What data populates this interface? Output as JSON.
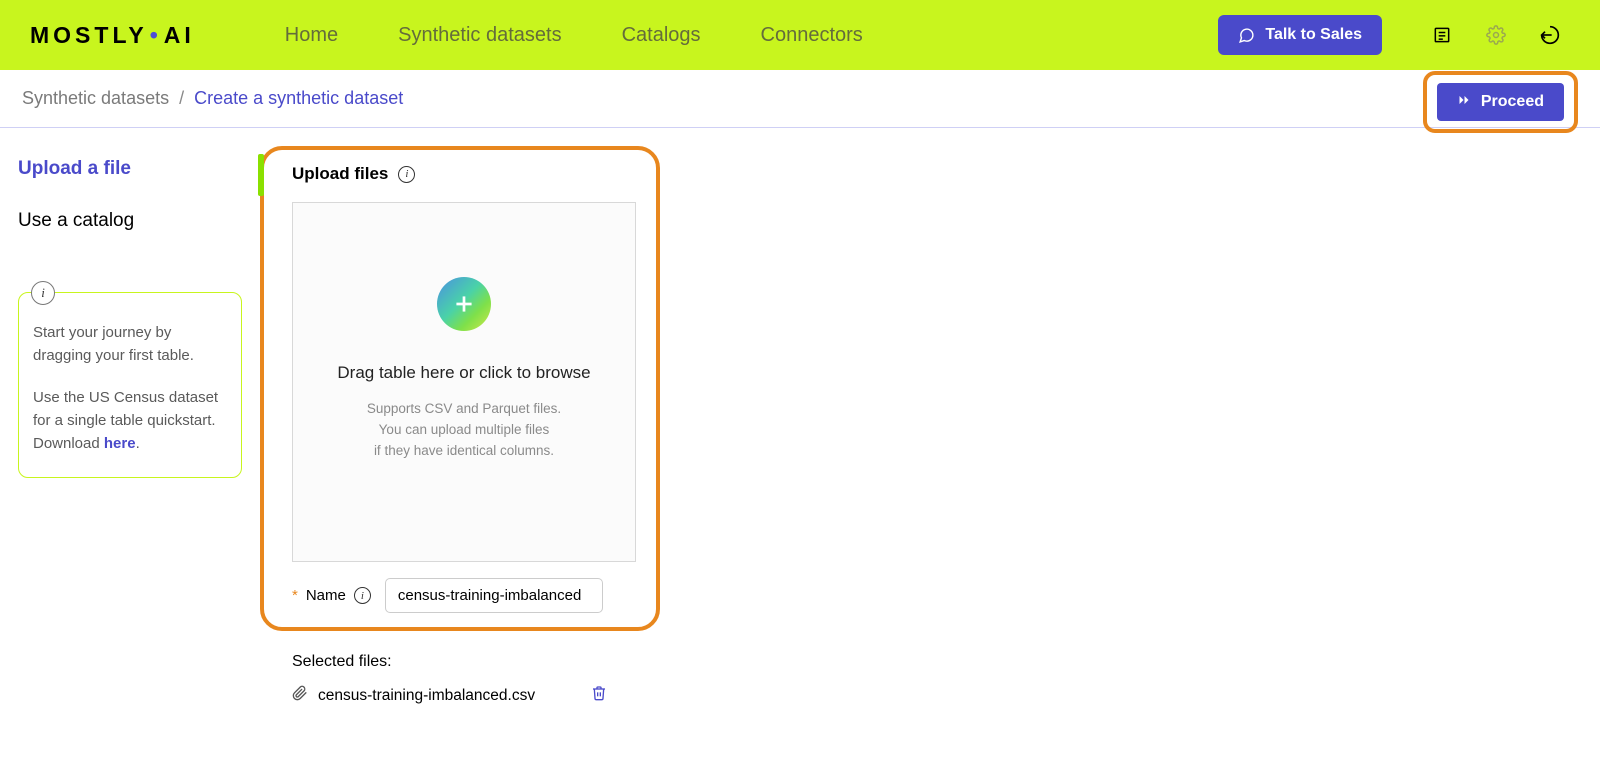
{
  "header": {
    "logo_part1": "MOSTLY",
    "logo_part2": "AI",
    "nav": [
      "Home",
      "Synthetic datasets",
      "Catalogs",
      "Connectors"
    ],
    "talk_to_sales": "Talk to Sales"
  },
  "breadcrumb": {
    "item1": "Synthetic datasets",
    "sep": "/",
    "item2": "Create a synthetic dataset"
  },
  "proceed": {
    "label": "Proceed"
  },
  "sidebar": {
    "upload_file": "Upload a file",
    "use_catalog": "Use a catalog",
    "info_p1": "Start your journey by dragging your first table.",
    "info_p2a": "Use the US Census dataset for a single table quickstart. Download ",
    "info_link": "here",
    "info_p2b": "."
  },
  "upload": {
    "title": "Upload files",
    "drop_main": "Drag table here or click to browse",
    "drop_sub1": "Supports CSV and Parquet files.",
    "drop_sub2": "You can upload multiple files",
    "drop_sub3": "if they have identical columns.",
    "name_label": "Name",
    "name_value": "census-training-imbalanced"
  },
  "selected": {
    "title": "Selected files:",
    "file1": "census-training-imbalanced.csv"
  }
}
